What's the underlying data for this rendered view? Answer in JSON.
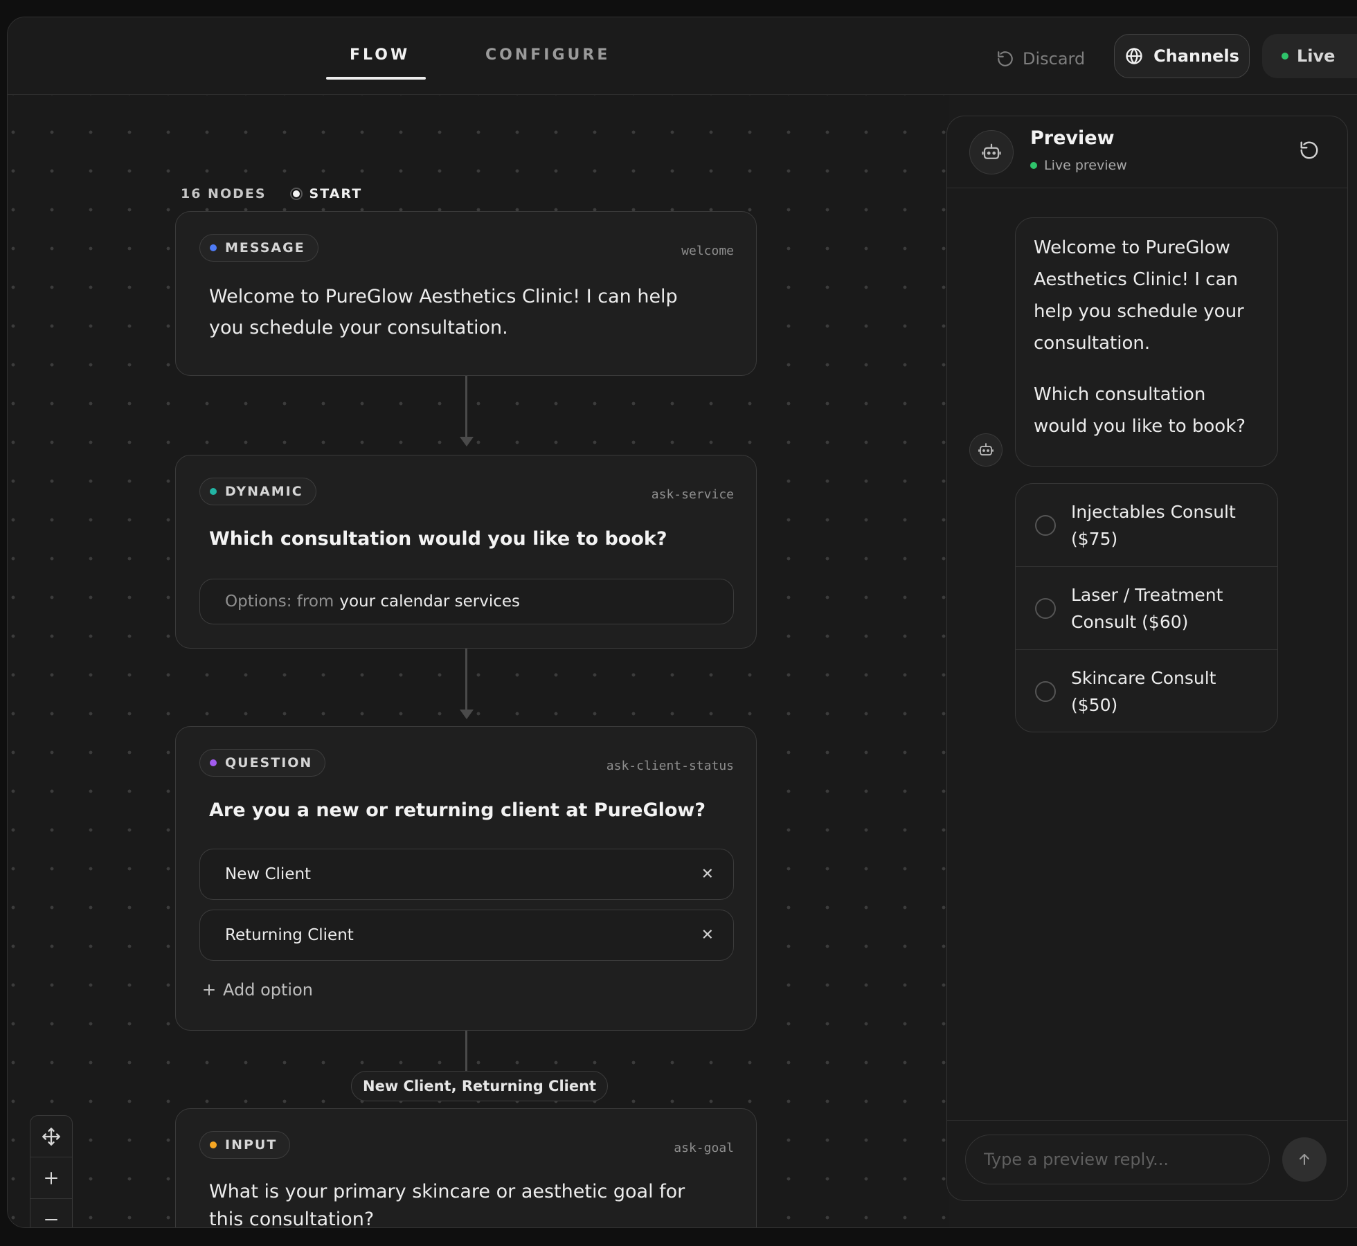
{
  "tabs": [
    {
      "label": "FLOW",
      "active": true
    },
    {
      "label": "CONFIGURE",
      "active": false
    }
  ],
  "actions": {
    "discard": "Discard",
    "channels": "Channels",
    "live": "Live"
  },
  "canvas": {
    "node_count": "16 NODES",
    "start_label": "START",
    "nodes": [
      {
        "type": "MESSAGE",
        "id": "welcome",
        "text": "Welcome to PureGlow Aesthetics Clinic! I can help you schedule your consultation."
      },
      {
        "type": "DYNAMIC",
        "id": "ask-service",
        "text": "Which consultation would you like to book?",
        "options_prefix": "Options: from",
        "options_source": "your calendar services"
      },
      {
        "type": "QUESTION",
        "id": "ask-client-status",
        "text": "Are you a new or returning client at PureGlow?",
        "options": [
          "New Client",
          "Returning Client"
        ],
        "add_option": "Add option"
      },
      {
        "type": "INPUT",
        "id": "ask-goal",
        "text": "What is your primary skincare or aesthetic goal for this consultation?"
      }
    ],
    "edge_label": "New Client, Returning Client"
  },
  "colors": {
    "message": "#4f7cf7",
    "dynamic": "#22b5a4",
    "question": "#a35cf0",
    "input": "#f5a623",
    "live_green": "#2fc46b"
  },
  "preview": {
    "title": "Preview",
    "subtitle": "Live preview",
    "bubble_paragraphs": [
      "Welcome to PureGlow Aesthetics Clinic! I can help you schedule your consultation.",
      "Which consultation would you like to book?"
    ],
    "choices": [
      "Injectables Consult ($75)",
      "Laser / Treatment Consult ($60)",
      "Skincare Consult ($50)"
    ],
    "reply_placeholder": "Type a preview reply..."
  }
}
